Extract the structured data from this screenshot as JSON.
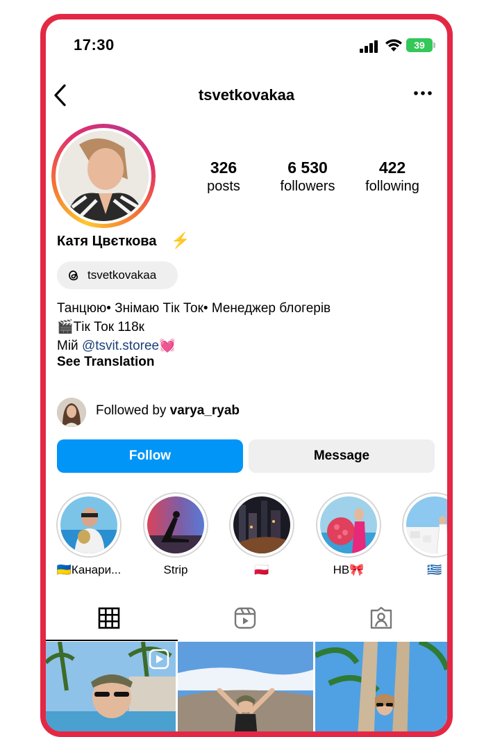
{
  "status_bar": {
    "time": "17:30",
    "battery": "39"
  },
  "header": {
    "username": "tsvetkovakaa"
  },
  "stats": [
    {
      "value": "326",
      "label": "posts"
    },
    {
      "value": "6 530",
      "label": "followers"
    },
    {
      "value": "422",
      "label": "following"
    }
  ],
  "profile": {
    "full_name": "Катя Цвєткова",
    "name_emoji": "⚡",
    "threads_handle": "tsvetkovakaa",
    "bio_line1": "Танцюю• Знімаю Тік Ток• Менеджер блогерів",
    "bio_line2": "🎬Тік Ток 118к",
    "bio_line3_prefix": "Мій ",
    "bio_line3_link": "@tsvit.storee",
    "bio_line3_emoji": "💓",
    "see_translation": "See Translation"
  },
  "followed_by": {
    "prefix": "Followed by ",
    "user": "varya_ryab"
  },
  "actions": {
    "follow": "Follow",
    "message": "Message"
  },
  "highlights": [
    {
      "label": "🇺🇦Канари..."
    },
    {
      "label": "Strip"
    },
    {
      "label": "🇵🇱"
    },
    {
      "label": "НВ🎀"
    },
    {
      "label": "🇬🇷"
    }
  ],
  "tabs": [
    {
      "icon": "grid-icon"
    },
    {
      "icon": "reels-icon"
    },
    {
      "icon": "tagged-icon"
    }
  ],
  "colors": {
    "follow": "#0095f6",
    "frame": "#e32845",
    "link": "#1c3f78"
  }
}
